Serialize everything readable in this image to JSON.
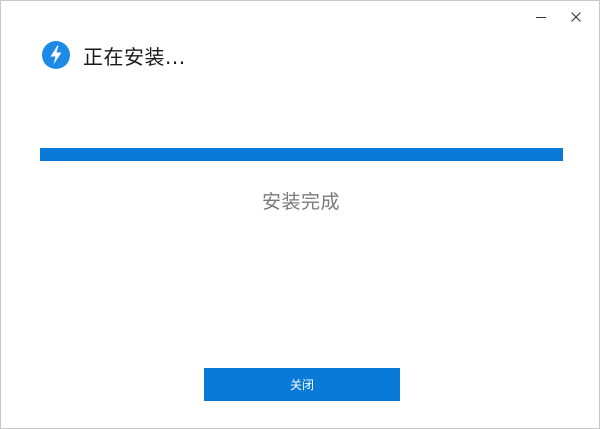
{
  "window": {
    "title": "正在安装...",
    "app_icon": "lightning-bolt-icon"
  },
  "window_controls": {
    "minimize_icon": "minimize-icon",
    "close_icon": "close-icon"
  },
  "progress": {
    "value": 1.0
  },
  "status": {
    "text": "安装完成"
  },
  "actions": {
    "close_label": "关闭"
  },
  "colors": {
    "accent": "#0a7ad9",
    "title_text": "#1a1a1a",
    "status_text": "#7a7a7a",
    "background": "#ffffff"
  }
}
